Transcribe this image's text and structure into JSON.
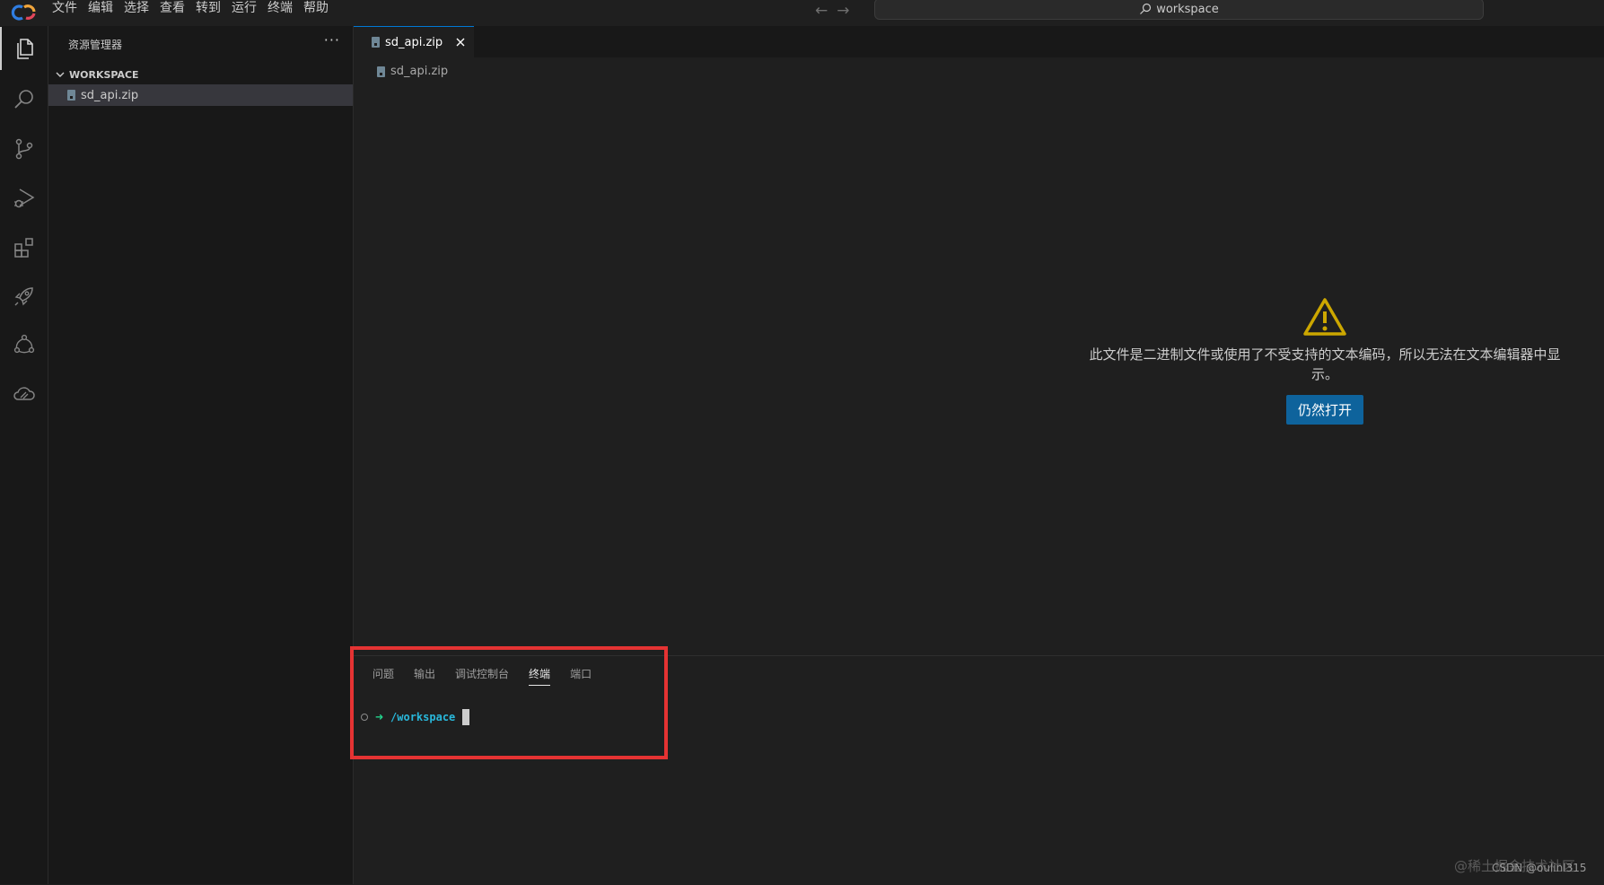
{
  "titlebar": {
    "menu": [
      "文件",
      "编辑",
      "选择",
      "查看",
      "转到",
      "运行",
      "终端",
      "帮助"
    ],
    "search": "workspace"
  },
  "activitybar": {
    "icons": [
      "explorer-icon",
      "search-icon",
      "source-control-icon",
      "run-debug-icon",
      "extensions-icon",
      "deploy-rocket-icon",
      "connections-icon",
      "cloud-icon"
    ]
  },
  "sidebar": {
    "title": "资源管理器",
    "more": "···",
    "workspace_label": "WORKSPACE",
    "files": [
      "sd_api.zip"
    ]
  },
  "editor": {
    "tab_label": "sd_api.zip",
    "breadcrumb": "sd_api.zip",
    "binary_message": "此文件是二进制文件或使用了不受支持的文本编码，所以无法在文本编辑器中显示。",
    "open_anyway": "仍然打开"
  },
  "panel": {
    "tabs": [
      "问题",
      "输出",
      "调试控制台",
      "终端",
      "端口"
    ],
    "active_tab": "终端",
    "terminal_path": "/workspace"
  },
  "watermark": {
    "line1": "@稀土掘金技术社区",
    "line2": "CSDN @oulinl315"
  },
  "colors": {
    "accent": "#0078d4",
    "button": "#0e639c",
    "warning": "#cca700",
    "highlight_box": "#e53333",
    "terminal_arrow": "#23d18b",
    "terminal_path": "#29b8db"
  }
}
